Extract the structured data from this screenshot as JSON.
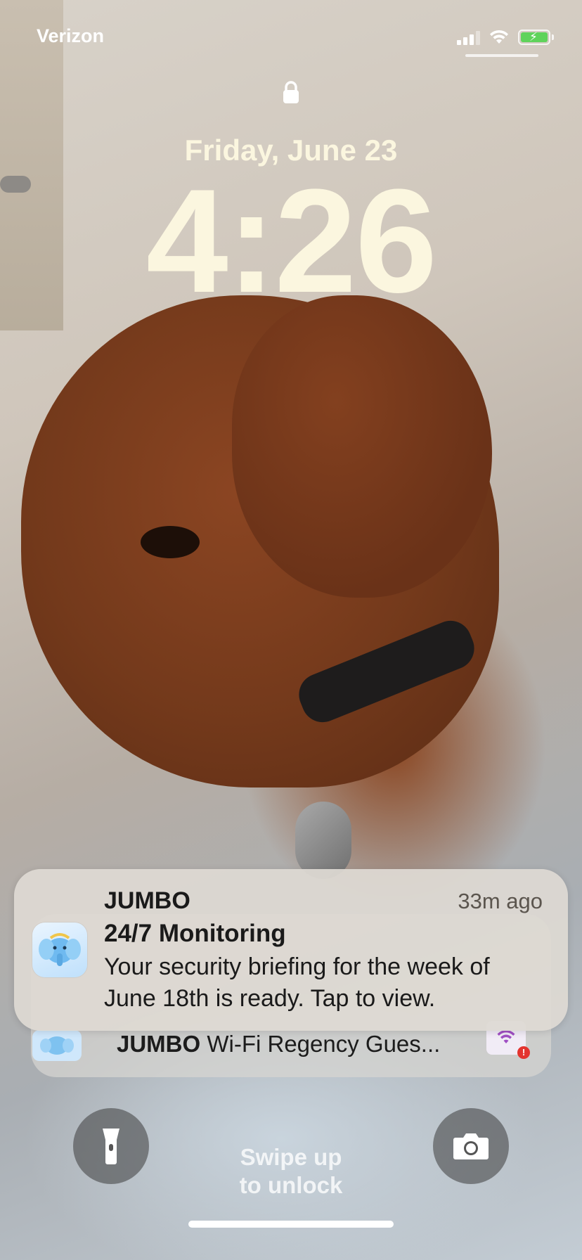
{
  "status_bar": {
    "carrier": "Verizon",
    "battery_charging": true,
    "battery_color": "#5fd35b"
  },
  "lock_screen": {
    "date": "Friday, June 23",
    "time": "4:26",
    "swipe_hint_line1": "Swipe up",
    "swipe_hint_line2": "to unlock"
  },
  "notification": {
    "app": "JUMBO",
    "time_ago": "33m ago",
    "title": "24/7 Monitoring",
    "body": "Your security briefing for the week of June 18th is ready. Tap to view.",
    "icon": "jumbo-elephant-icon"
  },
  "stacked_notification": {
    "app": "JUMBO",
    "preview": "Wi-Fi Regency Gues...",
    "icon": "jumbo-elephant-icon",
    "thumbnail_icon": "wifi-warning-icon"
  },
  "controls": {
    "left": "flashlight-icon",
    "right": "camera-icon"
  }
}
